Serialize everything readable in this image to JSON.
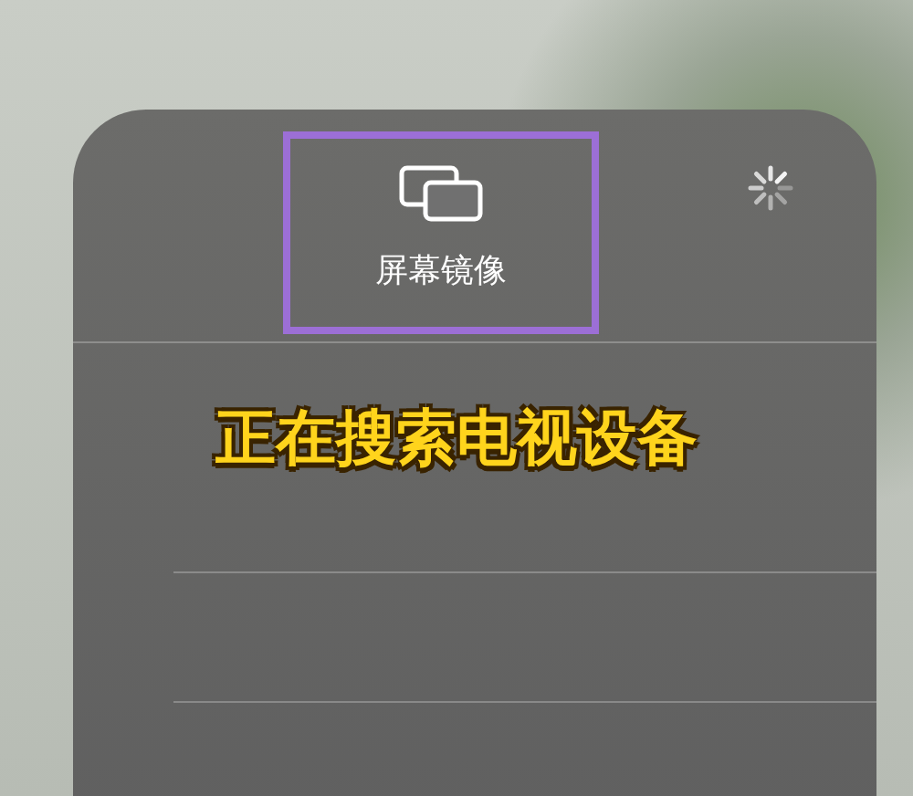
{
  "panel": {
    "title": "屏幕镜像",
    "highlighted": true,
    "searching": true
  },
  "caption": "正在搜索电视设备"
}
